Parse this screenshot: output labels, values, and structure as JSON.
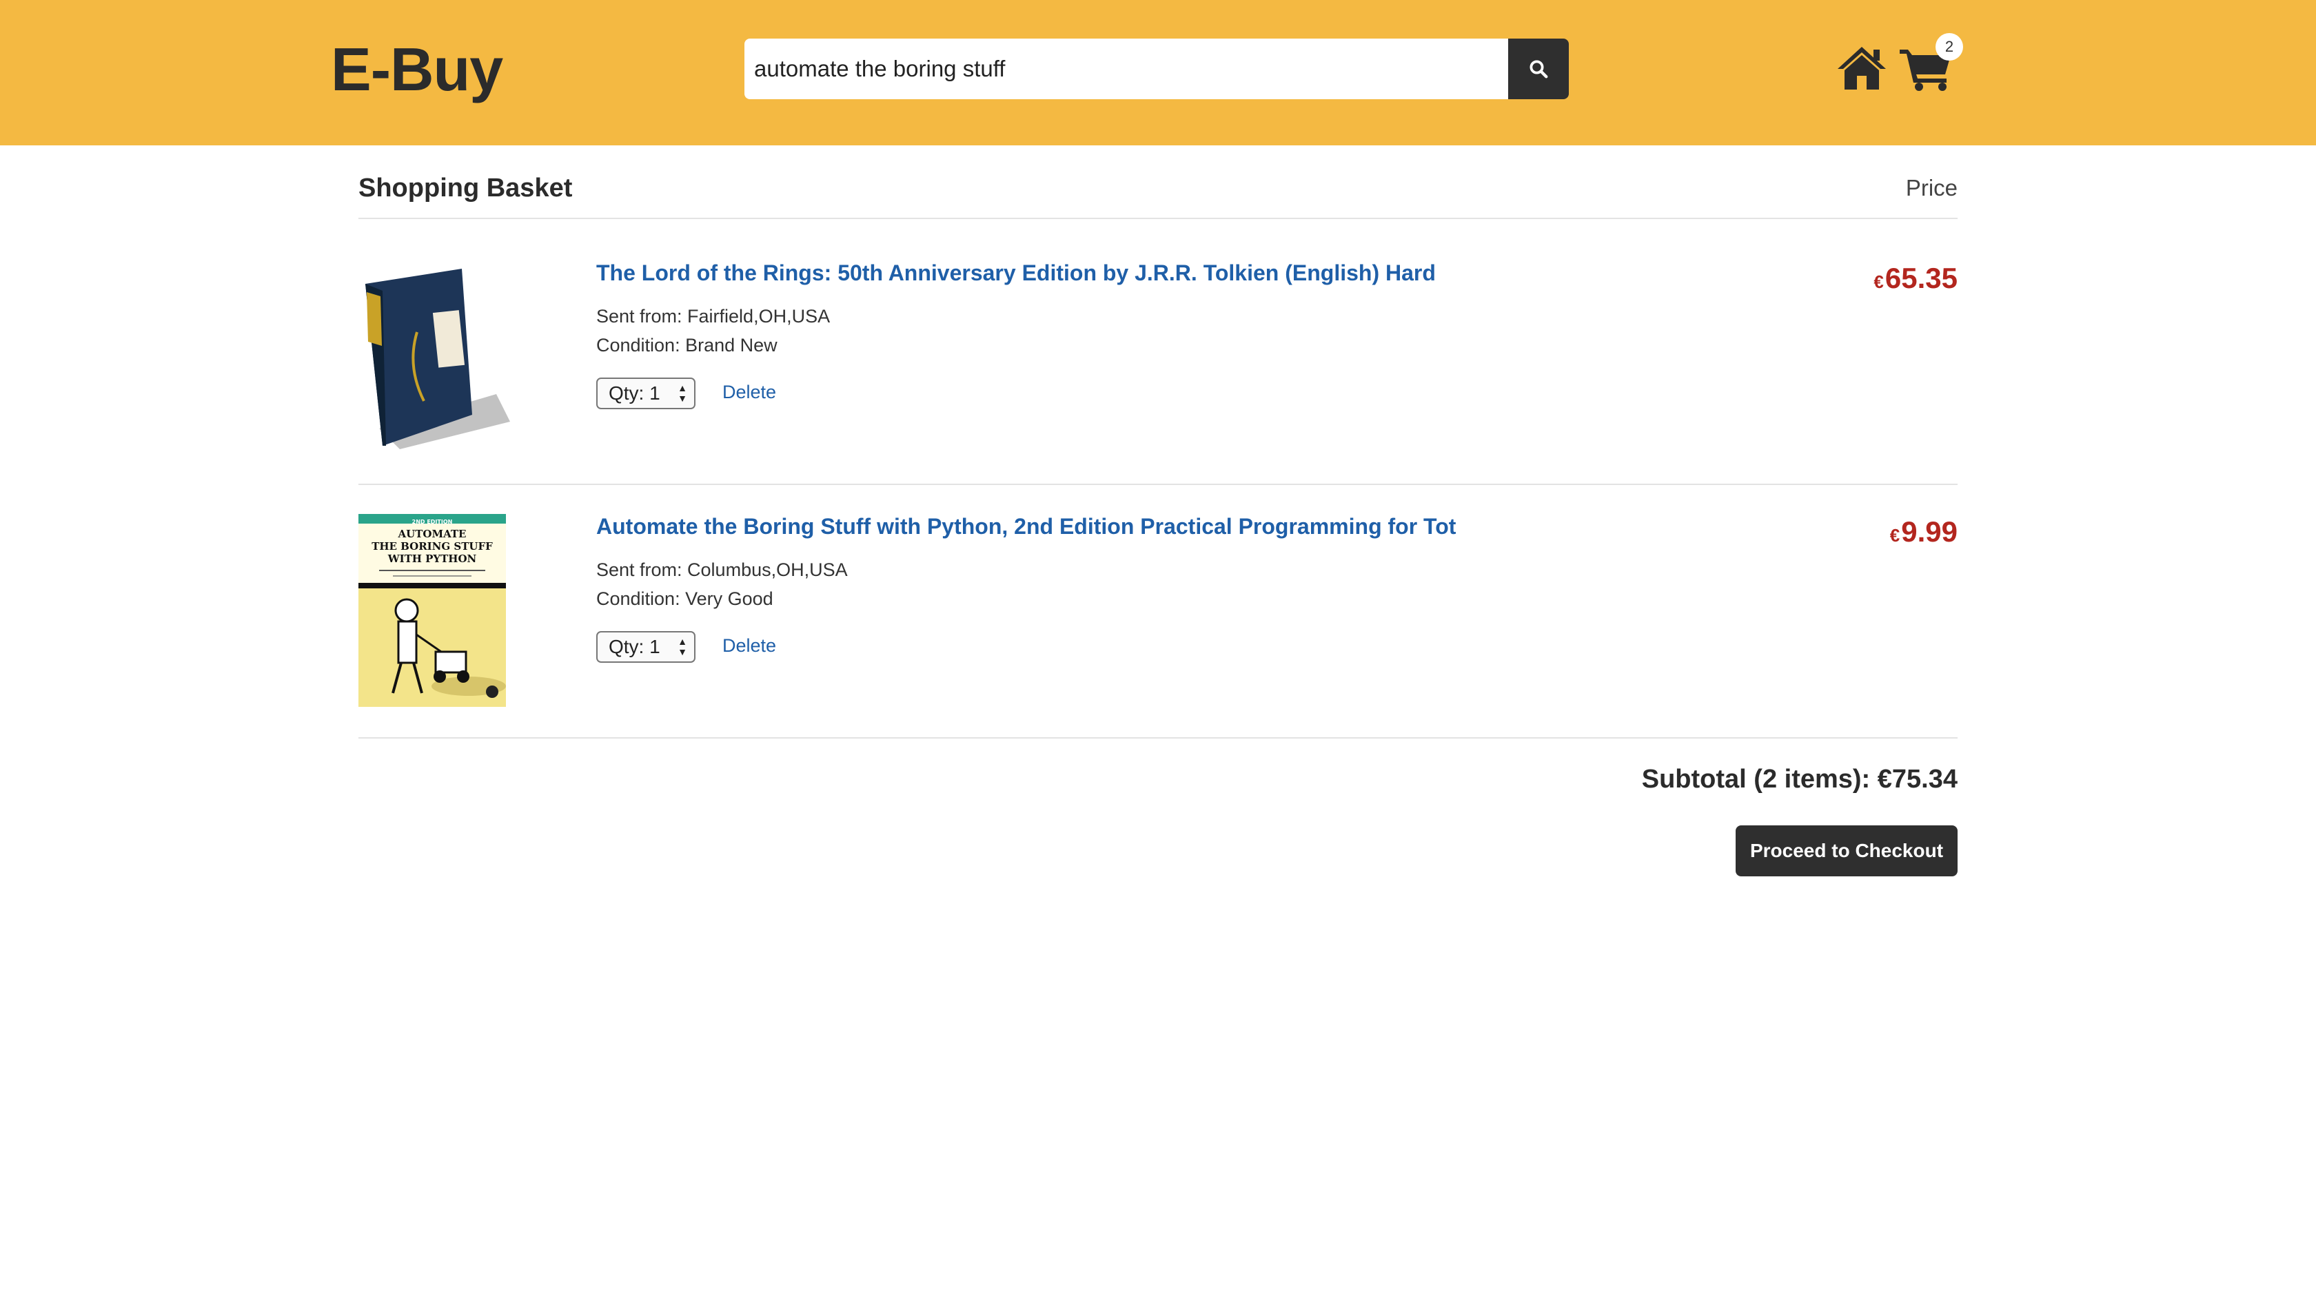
{
  "header": {
    "logo": "E-Buy",
    "search_value": "automate the boring stuff",
    "cart_count": "2",
    "brand_color": "#f4b942"
  },
  "basket": {
    "title": "Shopping Basket",
    "price_header": "Price",
    "items": [
      {
        "title": "The Lord of the Rings: 50th Anniversary Edition by J.R.R. Tolkien (English) Hard",
        "currency": "€",
        "price": "65.35",
        "sent_from": "Sent from: Fairfield,OH,USA",
        "condition": "Condition: Brand New",
        "qty_label": "Qty: 1",
        "delete_label": "Delete",
        "image_icon": "book-boxset-image"
      },
      {
        "title": "Automate the Boring Stuff with Python, 2nd Edition Practical Programming for Tot",
        "currency": "€",
        "price": "9.99",
        "sent_from": "Sent from: Columbus,OH,USA",
        "condition": "Condition: Very Good",
        "qty_label": "Qty: 1",
        "delete_label": "Delete",
        "image_icon": "book-cover-image",
        "cover_text": {
          "edition": "2ND EDITION",
          "line1": "AUTOMATE",
          "line2": "THE BORING STUFF",
          "line3": "WITH PYTHON"
        }
      }
    ],
    "subtotal": "Subtotal (2 items): €75.34",
    "checkout_label": "Proceed to Checkout"
  }
}
